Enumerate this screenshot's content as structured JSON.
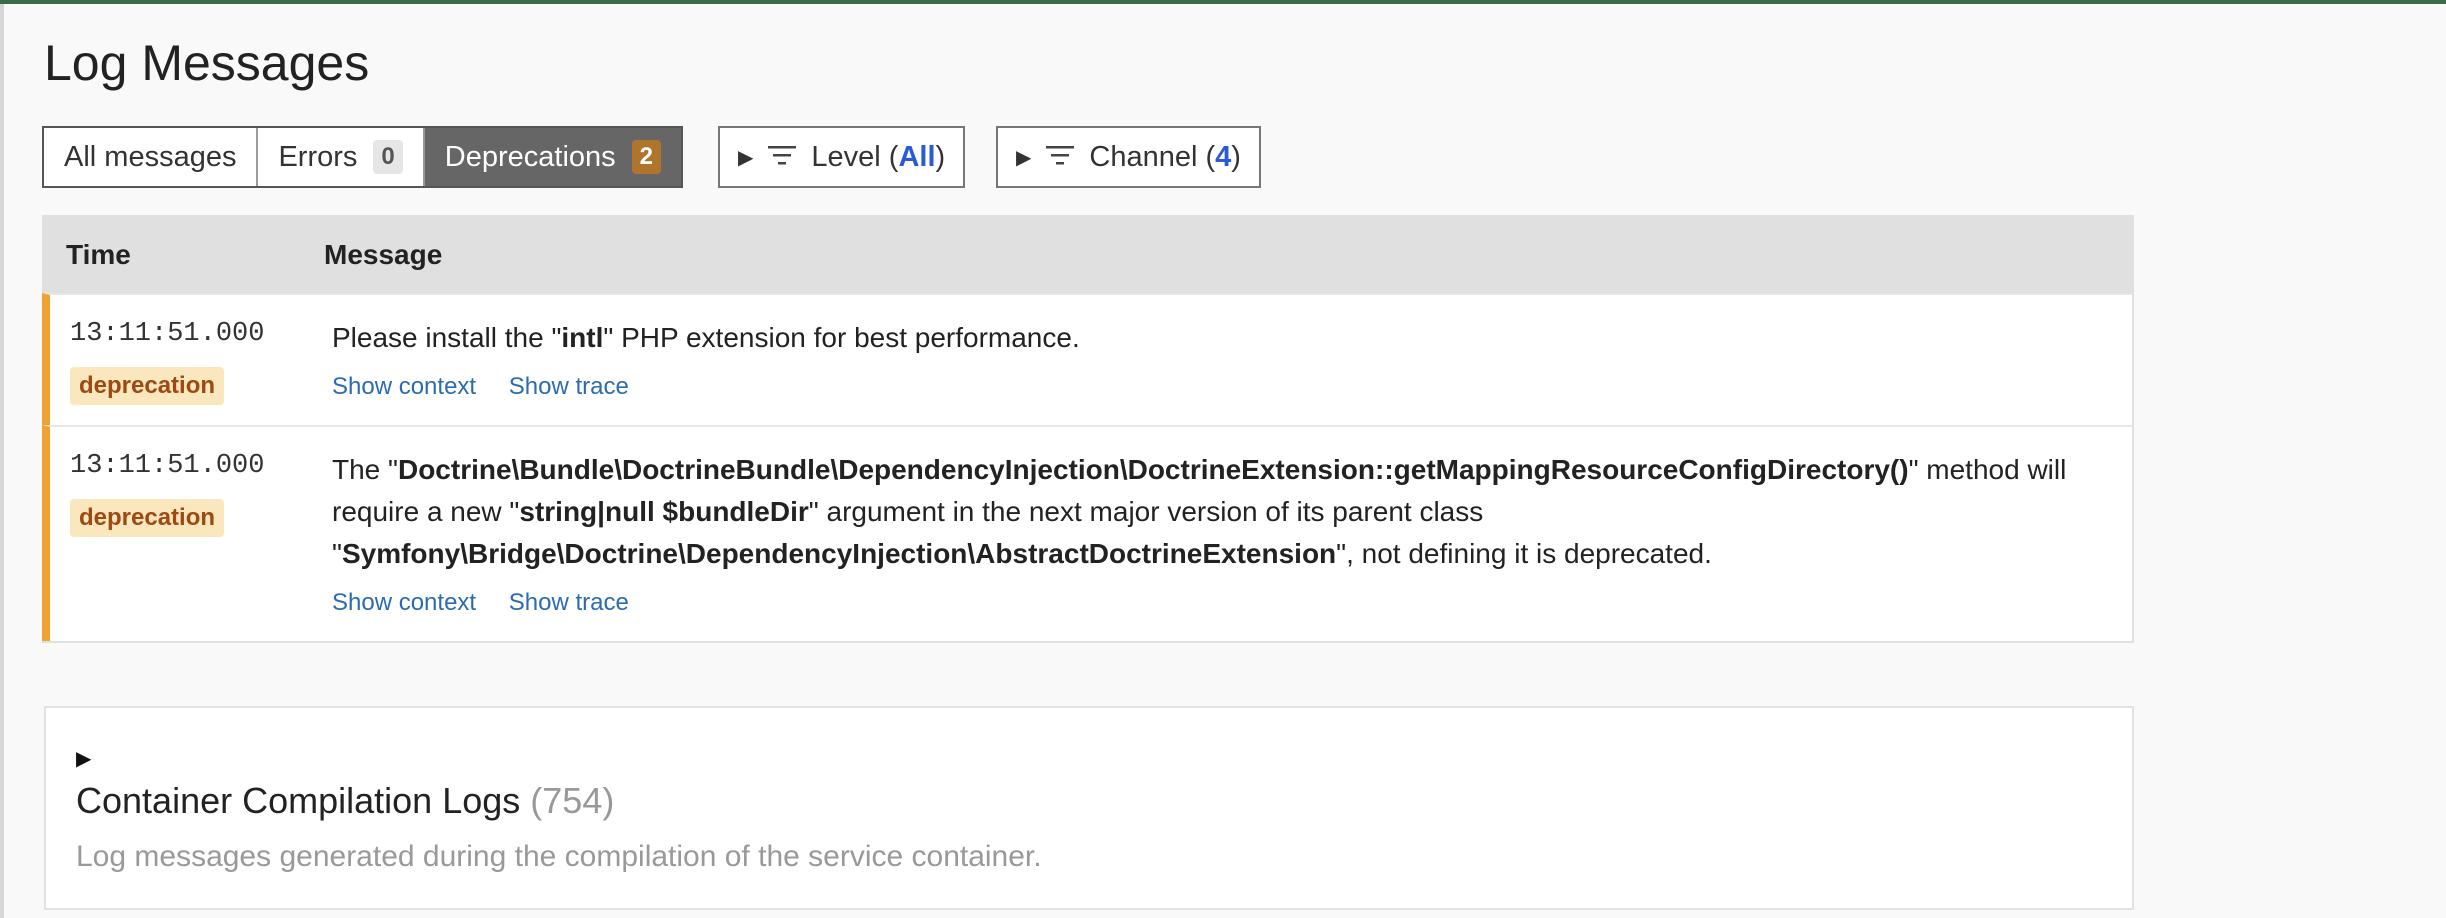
{
  "page_title": "Log Messages",
  "tabs": [
    {
      "label": "All messages",
      "count": null
    },
    {
      "label": "Errors",
      "count": "0"
    },
    {
      "label": "Deprecations",
      "count": "2"
    }
  ],
  "filters": {
    "level": {
      "label": "Level (",
      "value": "All",
      "close": ")"
    },
    "channel": {
      "label": "Channel (",
      "value": "4",
      "close": ")"
    }
  },
  "table": {
    "headers": {
      "time": "Time",
      "message": "Message"
    },
    "rows": [
      {
        "time": "13:11:51.000",
        "badge": "deprecation",
        "message_parts": [
          {
            "t": "Please install the \"",
            "b": false
          },
          {
            "t": "intl",
            "b": true
          },
          {
            "t": "\" PHP extension for best performance.",
            "b": false
          }
        ],
        "show_context": "Show context",
        "show_trace": "Show trace"
      },
      {
        "time": "13:11:51.000",
        "badge": "deprecation",
        "message_parts": [
          {
            "t": "The \"",
            "b": false
          },
          {
            "t": "Doctrine\\Bundle\\DoctrineBundle\\DependencyInjection\\DoctrineExtension::getMappingResourceConfigDirectory()",
            "b": true
          },
          {
            "t": "\" method will require a new \"",
            "b": false
          },
          {
            "t": "string|null $bundleDir",
            "b": true
          },
          {
            "t": "\" argument in the next major version of its parent class \"",
            "b": false
          },
          {
            "t": "Symfony\\Bridge\\Doctrine\\DependencyInjection\\AbstractDoctrineExtension",
            "b": true
          },
          {
            "t": "\", not defining it is deprecated.",
            "b": false
          }
        ],
        "show_context": "Show context",
        "show_trace": "Show trace"
      }
    ]
  },
  "container_logs": {
    "title": "Container Compilation Logs",
    "count": "(754)",
    "description": "Log messages generated during the compilation of the service container."
  },
  "colors": {
    "deprecation_border": "#f0a230",
    "active_tab_bg": "#666666",
    "active_badge_bg": "#b0752c",
    "link": "#2b6cb0",
    "filter_value": "#2a5bd7"
  }
}
